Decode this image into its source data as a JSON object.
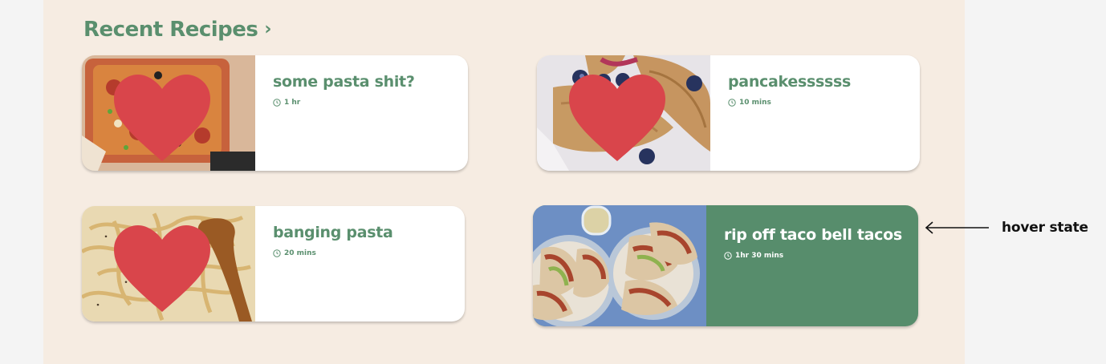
{
  "section": {
    "title": "Recent Recipes",
    "chevron": "›"
  },
  "recipes": [
    {
      "title": "some pasta shit?",
      "time": "1 hr",
      "favorite": true,
      "state": "default",
      "image": "pasta-bake"
    },
    {
      "title": "pancakessssss",
      "time": "10 mins",
      "favorite": true,
      "state": "default",
      "image": "crepes"
    },
    {
      "title": "banging pasta",
      "time": "20 mins",
      "favorite": true,
      "state": "default",
      "image": "spaghetti"
    },
    {
      "title": "rip off taco bell tacos",
      "time": "1hr 30 mins",
      "favorite": false,
      "state": "hover",
      "image": "tacos"
    }
  ],
  "annotation": {
    "text": "hover state"
  },
  "icons": {
    "favorite": "heart-icon",
    "time": "clock-icon",
    "arrow": "arrow-left-icon"
  },
  "colors": {
    "background": "#f6ece2",
    "accent": "#5a8f6e",
    "hover_card": "#578d6c",
    "heart": "#d9454b",
    "outer": "#f4f4f4"
  }
}
